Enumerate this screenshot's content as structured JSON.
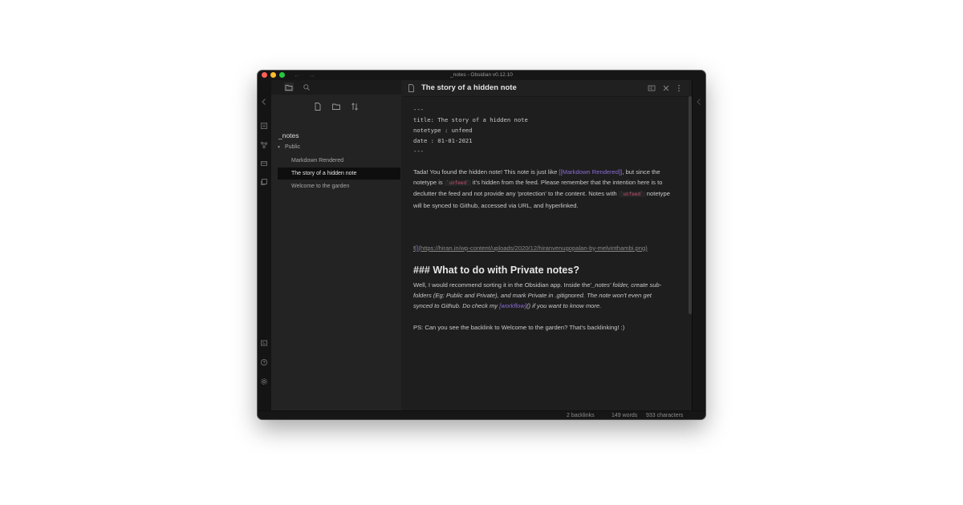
{
  "window": {
    "title": "_notes - Obsidian v0.12.10"
  },
  "sidebar": {
    "vault_name": "_notes",
    "folder": {
      "label": "Public",
      "expanded": true
    },
    "files": [
      {
        "label": "Markdown Rendered",
        "active": false
      },
      {
        "label": "The story of a hidden note",
        "active": true
      },
      {
        "label": "Welcome to the garden",
        "active": false
      }
    ]
  },
  "editor": {
    "title": "The story of a hidden note",
    "frontmatter": {
      "delim_open": "---",
      "title_line": "title: The story of a hidden note",
      "notetype_line": "notetype : unfeed",
      "date_line": "date : 01-01-2021",
      "delim_close": "---"
    },
    "para1": {
      "t1": "Tada! You found the hidden note! This note is just like ",
      "link": "[[Markdown Rendered]]",
      "t2": ", but since the notetype is ",
      "code1": "`unfeed`",
      "t3": " it's hidden from the feed. Please remember that the intention here is to declutter the feed and not provide any 'protection' to the content. Notes with ",
      "code2": "`unfeed`",
      "t4": " notetype will be synced to Github, accessed via URL, and hyperlinked."
    },
    "image_link": {
      "bang": "!",
      "brackets": "[]",
      "url": "(https://hiran.in/wp-content/uploads/2020/12/hiranvenugopalan-by-melvinthambi.png)"
    },
    "heading": "### What to do with Private notes?",
    "para2": {
      "t1": "Well, I would recommend sorting it in the Obsidian app. Inside the'",
      "i1": "_notes' folder, create sub-folders (Eg: Public and Private), and mark Private in .gitignored. The note won't even get synced to Github. Do check my ",
      "link": "[workflow]",
      "i2": "() if you want to know more."
    },
    "para3": "PS: Can you see the backlink to Welcome to the garden? That's backlinking! :)"
  },
  "status": {
    "backlinks": "2 backlinks",
    "words": "149 words",
    "characters": "933 characters"
  },
  "colors": {
    "link": "#8a6cd6",
    "code": "#c0506a",
    "background": "#1e1e1e"
  },
  "icons": {
    "ribbon": [
      "collapse-chevron-icon",
      "file-explorer-icon",
      "graph-view-icon",
      "switcher-icon",
      "templates-icon",
      "vault-switcher-icon",
      "help-icon",
      "settings-icon"
    ],
    "editor_header": [
      "file-icon",
      "reading-mode-icon",
      "close-icon",
      "more-options-icon"
    ]
  }
}
